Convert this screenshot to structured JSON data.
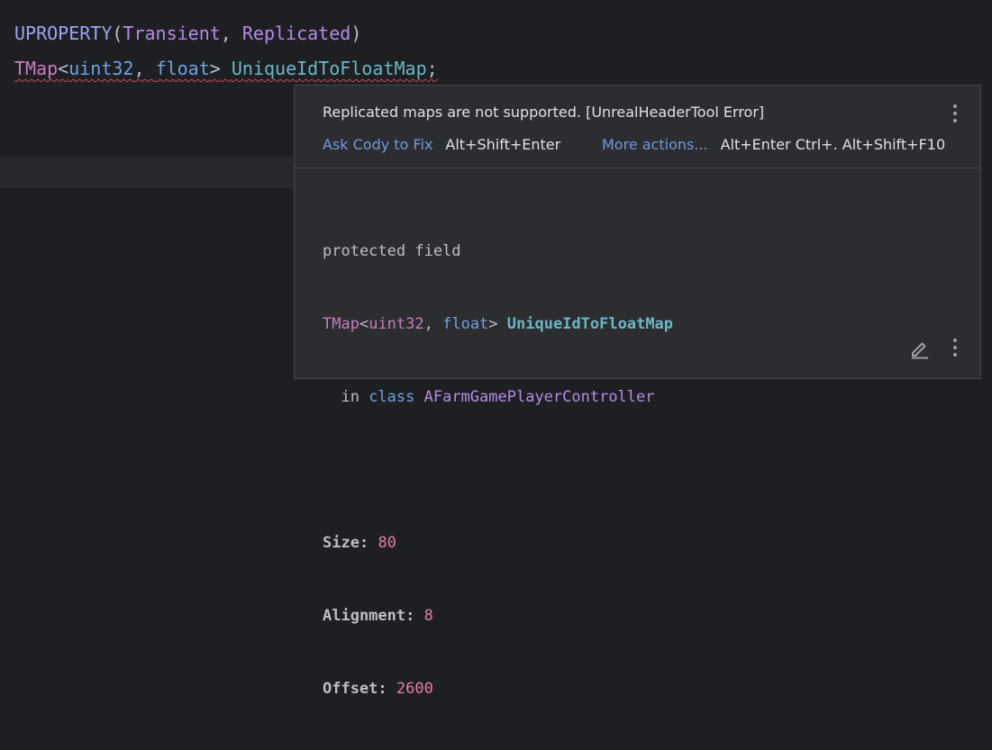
{
  "editor": {
    "line1": {
      "macro": "UPROPERTY",
      "open": "(",
      "p1": "Transient",
      "comma": ", ",
      "p2": "Replicated",
      "close": ")"
    },
    "line2": {
      "type": "TMap",
      "lt": "<",
      "t1": "uint32",
      "comma": ", ",
      "t2": "float",
      "gt": ">",
      "space": " ",
      "name": "UniqueIdToFloatMap",
      "semi": ";"
    }
  },
  "popup": {
    "error_message": "Replicated maps are not supported. [UnrealHeaderTool Error]",
    "actions": [
      {
        "label": "Ask Cody to Fix",
        "shortcut": "Alt+Shift+Enter"
      },
      {
        "label": "More actions...",
        "shortcut": "Alt+Enter Ctrl+. Alt+Shift+F10"
      }
    ],
    "doc": {
      "kind": "protected field",
      "sig_type": "TMap",
      "sig_lt": "<",
      "sig_t1": "uint32",
      "sig_comma": ", ",
      "sig_t2": "float",
      "sig_gt": ">",
      "sig_space": " ",
      "sig_name": "UniqueIdToFloatMap",
      "in_prefix": "  in ",
      "in_kw": "class",
      "in_space": " ",
      "in_class": "AFarmGamePlayerController",
      "size_label": "Size:",
      "size_value": "80",
      "align_label": "Alignment:",
      "align_value": "8",
      "offset_label": "Offset:",
      "offset_value": "2600"
    }
  },
  "icons": {
    "more": "vertical-ellipsis-icon",
    "edit": "pencil-icon"
  },
  "colors": {
    "background": "#1e1f22",
    "popup_bg": "#2b2d30",
    "link": "#6e9bdc",
    "error_underline": "#c94f4f"
  }
}
